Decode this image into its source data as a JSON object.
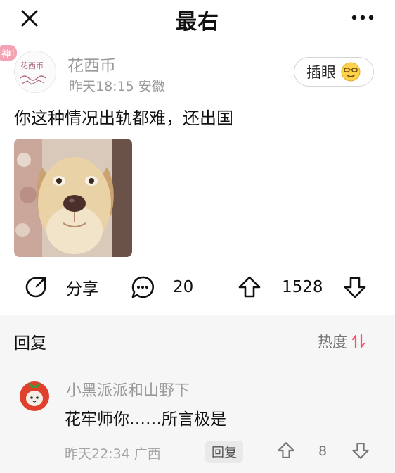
{
  "header": {
    "title": "最右",
    "close_icon": "close-icon",
    "more_icon": "more-dots-icon"
  },
  "post": {
    "badge_text": "神",
    "badge_mark": "!",
    "username": "花西币",
    "avatar_text": "花西币",
    "time_location": "昨天18:15 安徽",
    "follow_label": "插眼",
    "text": "你这种情况出轨都难，还出国",
    "image_desc_icon": "dog-photo"
  },
  "actions": {
    "share_label": "分享",
    "comment_count": "20",
    "like_count": "1528"
  },
  "replies": {
    "title": "回复",
    "sort_label": "热度",
    "sort_color": "#ff4d6d",
    "comments": [
      {
        "user": "小黑派派和山野下",
        "text": "花牢师你……所言极是",
        "meta": "昨天22:34 广西",
        "reply_label": "回复",
        "like_count": "8"
      }
    ]
  }
}
